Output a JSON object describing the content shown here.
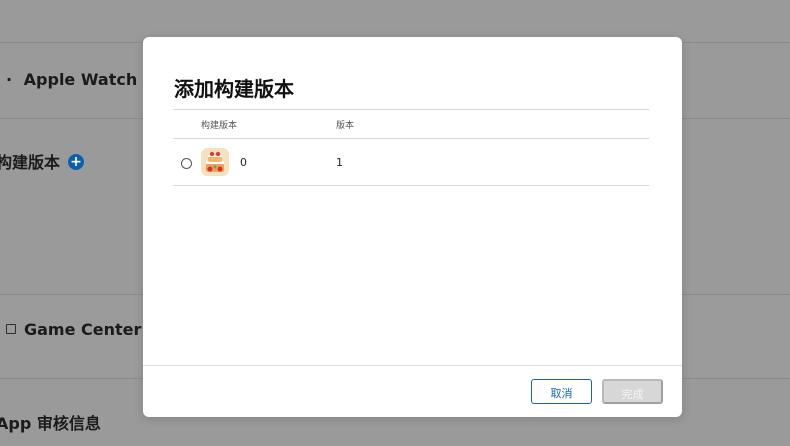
{
  "background": {
    "rows": [
      {
        "label": "Apple Watch",
        "prefix": "·"
      },
      {
        "label": "构建版本"
      },
      {
        "label": "Game Center"
      },
      {
        "label": "App 审核信息",
        "prefix": "A"
      }
    ],
    "add_icon": "plus-circle-icon"
  },
  "modal": {
    "title": "添加构建版本",
    "columns": {
      "build": "构建版本",
      "version": "版本"
    },
    "rows": [
      {
        "icon": "app-icon",
        "build": "0",
        "version": "1",
        "selected": false
      }
    ],
    "cancel_label": "取消",
    "done_label": "完成"
  },
  "colors": {
    "accent": "#1a63b3",
    "add_icon": "#0b5fb0",
    "disabled_button": "#d7d7d7"
  }
}
